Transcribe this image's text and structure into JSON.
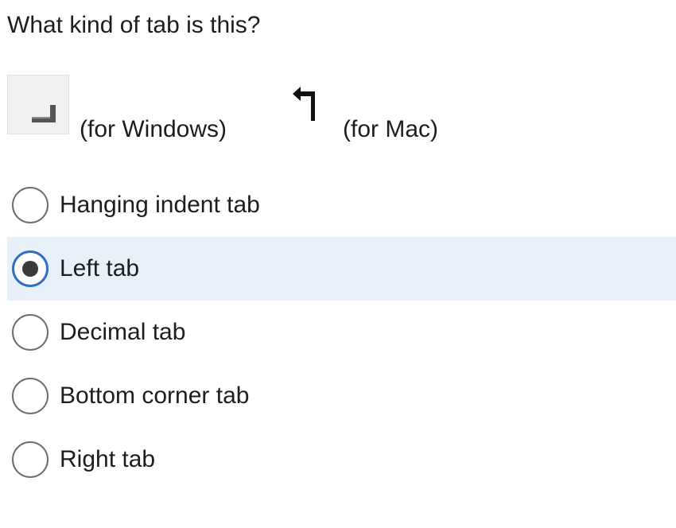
{
  "question": "What kind of tab is this?",
  "icons": {
    "windows": {
      "icon": "tab-stop-corner-icon",
      "caption": "(for Windows)"
    },
    "mac": {
      "icon": "up-left-arrow-icon",
      "caption": "(for Mac)"
    }
  },
  "options": [
    {
      "label": "Hanging indent tab",
      "selected": false
    },
    {
      "label": "Left tab",
      "selected": true
    },
    {
      "label": "Decimal tab",
      "selected": false
    },
    {
      "label": "Bottom corner tab",
      "selected": false
    },
    {
      "label": "Right tab",
      "selected": false
    }
  ],
  "colors": {
    "selected_background": "#e8f0fa",
    "selected_ring": "#2f6fc4",
    "radio_border": "#6d6d6d"
  }
}
